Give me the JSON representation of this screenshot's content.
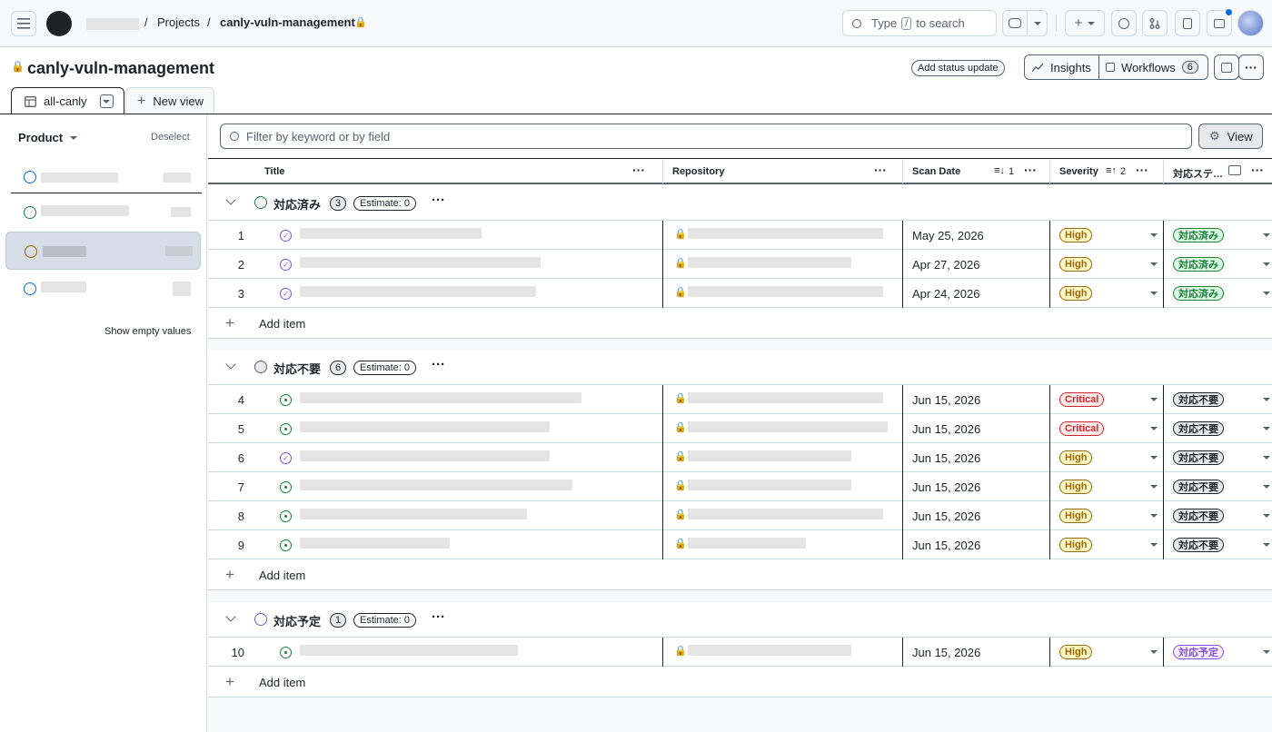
{
  "breadcrumb": {
    "sep1": "/",
    "projects": "Projects",
    "sep2": "/",
    "repo": "canly-vuln-management"
  },
  "search": {
    "prefix": "Type",
    "key": "/",
    "suffix": "to search"
  },
  "project": {
    "title": "canly-vuln-management",
    "status_update": "Add status update",
    "insights": "Insights",
    "workflows": "Workflows",
    "workflows_count": "6"
  },
  "tabs": {
    "active": "all-canly",
    "new_view": "New view"
  },
  "sidebar": {
    "heading": "Product",
    "deselect": "Deselect",
    "show_empty": "Show empty values"
  },
  "filter": {
    "placeholder": "Filter by keyword or by field",
    "view": "View"
  },
  "columns": {
    "title": "Title",
    "repository": "Repository",
    "scan_date": "Scan Date",
    "scan_sort": "1",
    "severity": "Severity",
    "sev_sort": "2",
    "status": "対応ステ…"
  },
  "groups": [
    {
      "name": "対応済み",
      "count": "3",
      "estimate": "Estimate: 0",
      "add": "Add item",
      "rows": [
        {
          "n": "1",
          "date": "May 25, 2026",
          "sev": "High",
          "status": "対応済み"
        },
        {
          "n": "2",
          "date": "Apr 27, 2026",
          "sev": "High",
          "status": "対応済み"
        },
        {
          "n": "3",
          "date": "Apr 24, 2026",
          "sev": "High",
          "status": "対応済み"
        }
      ]
    },
    {
      "name": "対応不要",
      "count": "6",
      "estimate": "Estimate: 0",
      "add": "Add item",
      "rows": [
        {
          "n": "4",
          "date": "Jun 15, 2026",
          "sev": "Critical",
          "status": "対応不要"
        },
        {
          "n": "5",
          "date": "Jun 15, 2026",
          "sev": "Critical",
          "status": "対応不要"
        },
        {
          "n": "6",
          "date": "Jun 15, 2026",
          "sev": "High",
          "status": "対応不要"
        },
        {
          "n": "7",
          "date": "Jun 15, 2026",
          "sev": "High",
          "status": "対応不要"
        },
        {
          "n": "8",
          "date": "Jun 15, 2026",
          "sev": "High",
          "status": "対応不要"
        },
        {
          "n": "9",
          "date": "Jun 15, 2026",
          "sev": "High",
          "status": "対応不要"
        }
      ]
    },
    {
      "name": "対応予定",
      "count": "1",
      "estimate": "Estimate: 0",
      "add": "Add item",
      "rows": [
        {
          "n": "10",
          "date": "Jun 15, 2026",
          "sev": "High",
          "status": "対応予定"
        }
      ]
    }
  ],
  "colors": {
    "green": "#1a7f37",
    "gray": "#59636e",
    "purple": "#8250df",
    "high_bg": "#fff8c5",
    "high_fg": "#9a6700",
    "crit_bg": "#ffebe9",
    "crit_fg": "#d1242f"
  }
}
